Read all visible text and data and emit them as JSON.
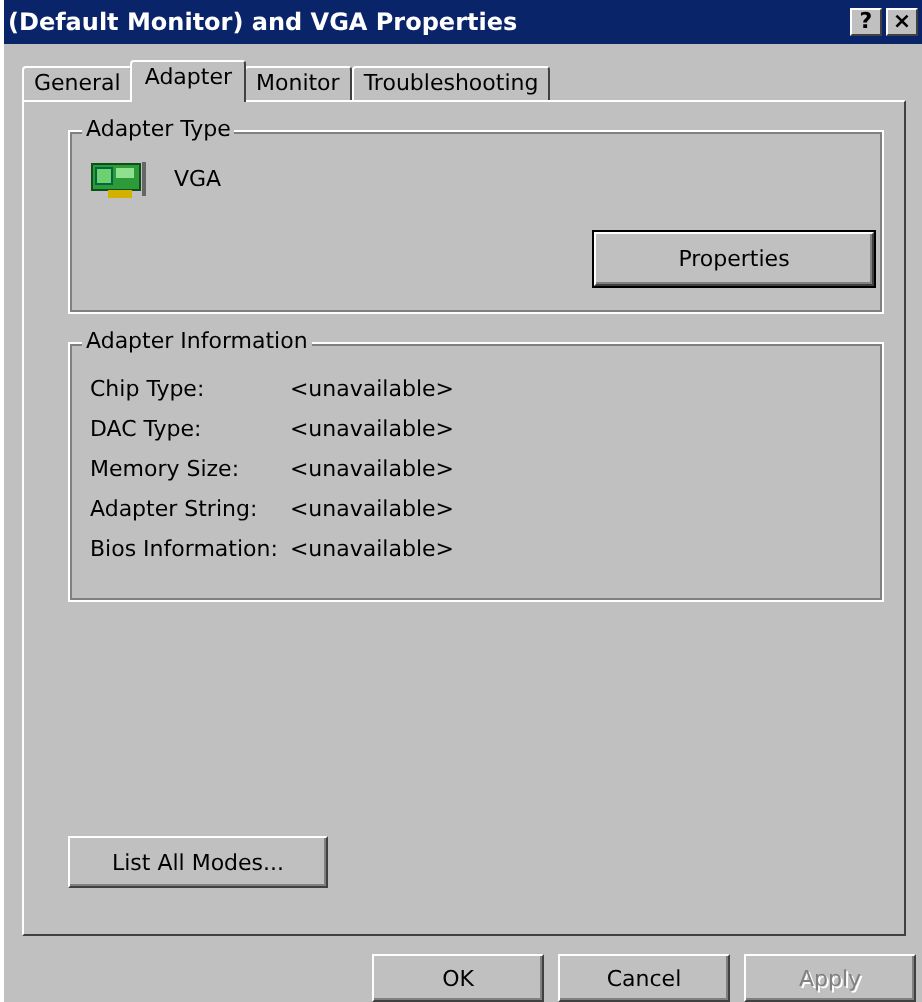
{
  "window": {
    "title": "(Default Monitor) and VGA Properties",
    "title_buttons": [
      "?",
      "×"
    ]
  },
  "tabs": [
    {
      "label": "General",
      "selected": false
    },
    {
      "label": "Adapter",
      "selected": true
    },
    {
      "label": "Monitor",
      "selected": false
    },
    {
      "label": "Troubleshooting",
      "selected": false
    }
  ],
  "adapter_type": {
    "heading": "Adapter Type",
    "name": "VGA",
    "button": {
      "label": "Properties",
      "default": true
    }
  },
  "adapter_information": {
    "heading": "Adapter Information",
    "rows": [
      {
        "label": "Chip Type:",
        "value": "<unavailable>"
      },
      {
        "label": "DAC Type:",
        "value": "<unavailable>"
      },
      {
        "label": "Memory Size:",
        "value": "<unavailable>"
      },
      {
        "label": "Adapter String:",
        "value": "<unavailable>"
      },
      {
        "label": "Bios Information:",
        "value": "<unavailable>"
      }
    ]
  },
  "list_modes_button": {
    "label": "List All Modes...",
    "default": false
  },
  "buttons": [
    {
      "label": "OK",
      "disabled": false
    },
    {
      "label": "Cancel",
      "disabled": false
    },
    {
      "label": "Apply",
      "disabled": true
    }
  ]
}
